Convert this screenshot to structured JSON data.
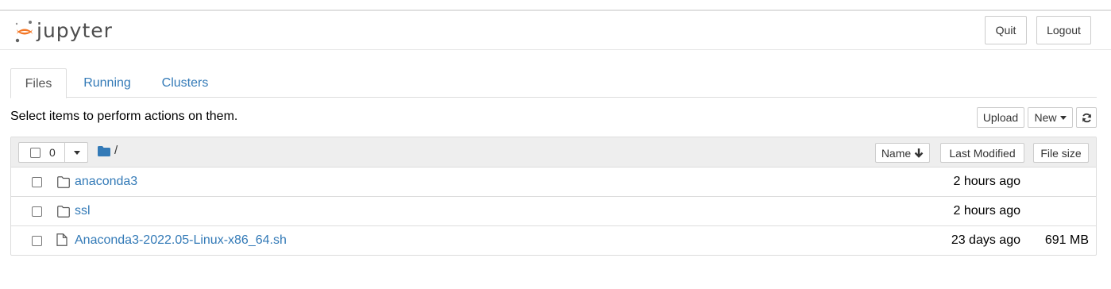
{
  "header": {
    "logo_text": "jupyter",
    "quit_label": "Quit",
    "logout_label": "Logout"
  },
  "tabs": [
    {
      "label": "Files",
      "active": true
    },
    {
      "label": "Running",
      "active": false
    },
    {
      "label": "Clusters",
      "active": false
    }
  ],
  "toolbar": {
    "instructions": "Select items to perform actions on them.",
    "upload_label": "Upload",
    "new_label": "New",
    "refresh_icon": "refresh-icon"
  },
  "list_header": {
    "selected_count": "0",
    "breadcrumb": "/",
    "sort_name_label": "Name",
    "sort_modified_label": "Last Modified",
    "sort_size_label": "File size"
  },
  "files": [
    {
      "name": "anaconda3",
      "type": "folder",
      "modified": "2 hours ago",
      "size": ""
    },
    {
      "name": "ssl",
      "type": "folder",
      "modified": "2 hours ago",
      "size": ""
    },
    {
      "name": "Anaconda3-2022.05-Linux-x86_64.sh",
      "type": "file",
      "modified": "23 days ago",
      "size": "691 MB"
    }
  ],
  "colors": {
    "link": "#337ab7",
    "logo_orange": "#F37726",
    "header_bg": "#eeeeee"
  }
}
